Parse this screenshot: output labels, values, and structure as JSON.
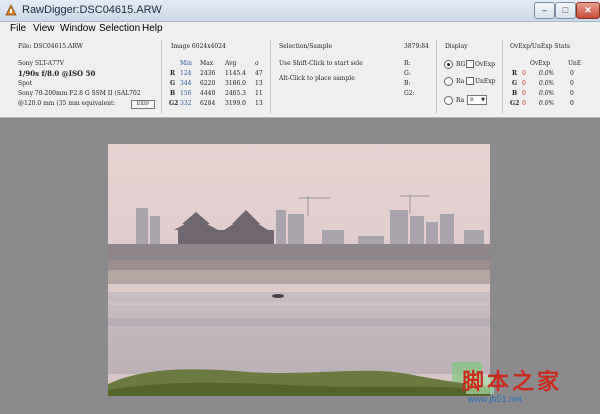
{
  "window": {
    "title": "RawDigger:DSC04615.ARW",
    "min_glyph": "–",
    "max_glyph": "□",
    "close_glyph": "✕"
  },
  "menu": [
    "File",
    "View",
    "Window",
    "Selection",
    "Help"
  ],
  "file_info": {
    "file": "File: DSC04615.ARW",
    "camera": "Sony SLT-A77V",
    "exposure": "1/90s f/8.0 @ISO 50",
    "metering": "Spot",
    "lens": "Sony 70-200mm F2.8 G SSM II (SAL702",
    "focal": "@120.0 mm (35 mm equivalent:",
    "exif_button": "EXIF"
  },
  "stats": {
    "image_size": "Image 6024x4024",
    "headers": [
      "Min",
      "Max",
      "Avg",
      "σ"
    ],
    "rows": [
      {
        "ch": "R",
        "min": "124",
        "max": "2436",
        "avg": "1145.4",
        "sd": "47"
      },
      {
        "ch": "G",
        "min": "344",
        "max": "6220",
        "avg": "3186.0",
        "sd": "13"
      },
      {
        "ch": "B",
        "min": "156",
        "max": "4440",
        "avg": "2465.3",
        "sd": "11"
      },
      {
        "ch": "G2",
        "min": "332",
        "max": "6284",
        "avg": "3199.0",
        "sd": "13"
      }
    ]
  },
  "selection": {
    "title": "Selection/Sample",
    "hint1": "Use Shift-Click to start sele",
    "hint2": "Alt-Click to place sample"
  },
  "coords": {
    "xy": "3879:84",
    "labels": [
      "R:",
      "G:",
      "B:",
      "G2:"
    ]
  },
  "display": {
    "title": "Display",
    "options": [
      {
        "label": "RG",
        "checkbox": "OvExp",
        "selected": true
      },
      {
        "label": "Ra",
        "checkbox": "UnExp",
        "selected": false
      },
      {
        "label": "Ra",
        "dropdown": "R",
        "selected": false
      }
    ],
    "dropdown_arrow": "▼"
  },
  "ovexp": {
    "title": "OvExp/UnExp Stats",
    "col1": "OvExp",
    "col2": "UnE",
    "rows": [
      {
        "ch": "R",
        "ov_count": "0",
        "ov_pct": "0.0%",
        "un": "0"
      },
      {
        "ch": "G",
        "ov_count": "0",
        "ov_pct": "0.0%",
        "un": "0"
      },
      {
        "ch": "B",
        "ov_count": "0",
        "ov_pct": "0.0%",
        "un": "0"
      },
      {
        "ch": "G2",
        "ov_count": "0",
        "ov_pct": "0.0%",
        "un": "0"
      }
    ]
  },
  "watermark": {
    "text": "脚本之家",
    "url": "www.jb51.net"
  },
  "icons": {
    "app": "rawdigger-app-icon"
  }
}
